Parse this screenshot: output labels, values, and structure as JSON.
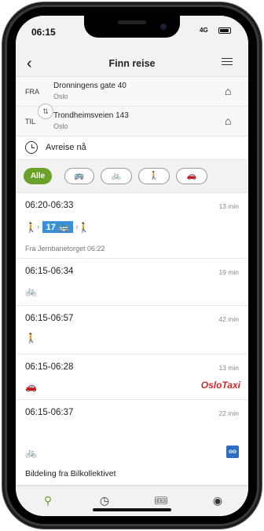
{
  "status": {
    "time": "06:15",
    "network": "4G"
  },
  "header": {
    "back_label": "‹",
    "title": "Finn reise"
  },
  "from": {
    "label": "FRA",
    "address": "Dronningens gate 40",
    "city": "Oslo"
  },
  "to": {
    "label": "TIL",
    "address": "Trondheimsveien 143",
    "city": "Oslo"
  },
  "depart": {
    "text": "Avreise nå"
  },
  "filters": {
    "all": "Alle",
    "bus_icon": "bus-icon",
    "bike_icon": "bicycle-icon",
    "walk_icon": "walk-icon",
    "car_icon": "car-icon"
  },
  "trips": [
    {
      "time": "06:20-06:33",
      "duration": "13 min",
      "line": "17",
      "sub": "Fra Jernbanetorget 06:22"
    },
    {
      "time": "06:15-06:34",
      "duration": "19 min"
    },
    {
      "time": "06:15-06:57",
      "duration": "42 min"
    },
    {
      "time": "06:15-06:28",
      "duration": "13 min",
      "provider": "OsloTaxi"
    },
    {
      "time": "06:15-06:37",
      "duration": "22 min",
      "sub": "Bildeling fra Bilkollektivet",
      "provider": "oo"
    }
  ],
  "colors": {
    "accent": "#6aa128",
    "bus": "#3b8fd4",
    "taxi": "#d12a2a"
  }
}
